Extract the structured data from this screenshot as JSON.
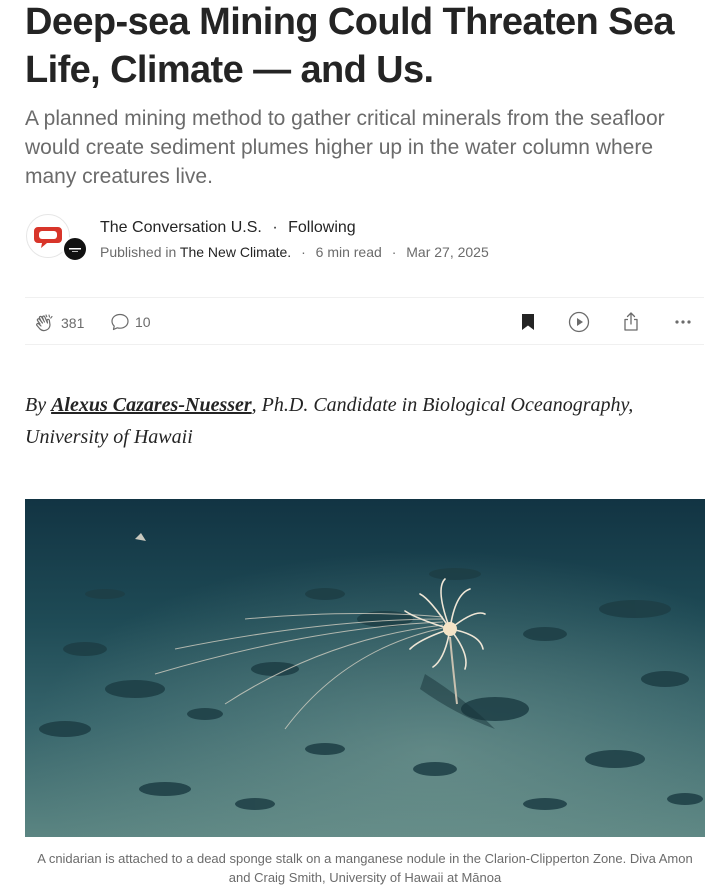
{
  "article": {
    "title": "Deep-sea Mining Could Threaten Sea Life, Climate — and Us.",
    "subtitle": "A planned mining method to gather critical minerals from the seafloor would create sediment plumes higher up in the water column where many creatures live."
  },
  "author": {
    "name": "The Conversation U.S.",
    "follow_label": "Following",
    "published_in_label": "Published in",
    "publication": "The New Climate.",
    "read_time": "6 min read",
    "date": "Mar 27, 2025",
    "separator": "·"
  },
  "actions": {
    "clap_count": "381",
    "comment_count": "10",
    "icons": [
      "clap-icon",
      "comment-icon",
      "bookmark-icon",
      "play-icon",
      "share-icon",
      "more-icon"
    ]
  },
  "byline": {
    "prefix": "By",
    "name": "Alexus Cazares-Nuesser",
    "rest": ", Ph.D. Candidate in Biological Oceanography, University of Hawaii"
  },
  "figure": {
    "caption": "A cnidarian is attached to a dead sponge stalk on a manganese nodule in the Clarion-Clipperton Zone. Diva Amon and Craig Smith, University of Hawaii at Mānoa"
  },
  "colors": {
    "text": "#242424",
    "muted": "#6b6b6b",
    "conversation_red": "#d8352a"
  }
}
